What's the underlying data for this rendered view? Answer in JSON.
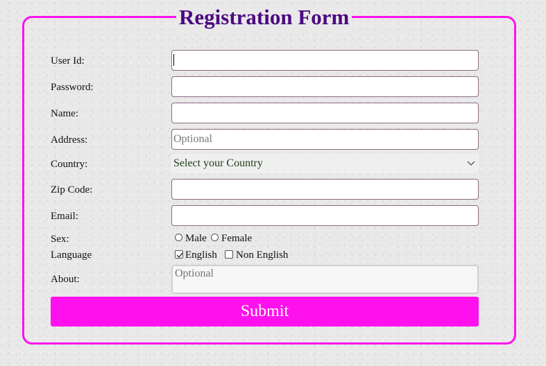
{
  "form": {
    "legend": "Registration Form",
    "fields": {
      "user_id": {
        "label": "User Id:",
        "value": "",
        "placeholder": ""
      },
      "password": {
        "label": "Password:",
        "value": "",
        "placeholder": ""
      },
      "name": {
        "label": "Name:",
        "value": "",
        "placeholder": ""
      },
      "address": {
        "label": "Address:",
        "value": "",
        "placeholder": "Optional"
      },
      "country": {
        "label": "Country:",
        "selected": "Select your Country"
      },
      "zip_code": {
        "label": "Zip Code:",
        "value": "",
        "placeholder": ""
      },
      "email": {
        "label": "Email:",
        "value": "",
        "placeholder": ""
      },
      "sex": {
        "label": "Sex:",
        "options": [
          {
            "label": "Male",
            "checked": false
          },
          {
            "label": "Female",
            "checked": false
          }
        ]
      },
      "language": {
        "label": "Language",
        "options": [
          {
            "label": "English",
            "checked": true
          },
          {
            "label": "Non English",
            "checked": false
          }
        ]
      },
      "about": {
        "label": "About:",
        "placeholder": "Optional"
      }
    },
    "submit_label": "Submit"
  },
  "colors": {
    "accent": "#ff11ee",
    "legend_text": "#4b0a82",
    "background": "#e9e9e9",
    "select_text": "#1e3b16"
  }
}
